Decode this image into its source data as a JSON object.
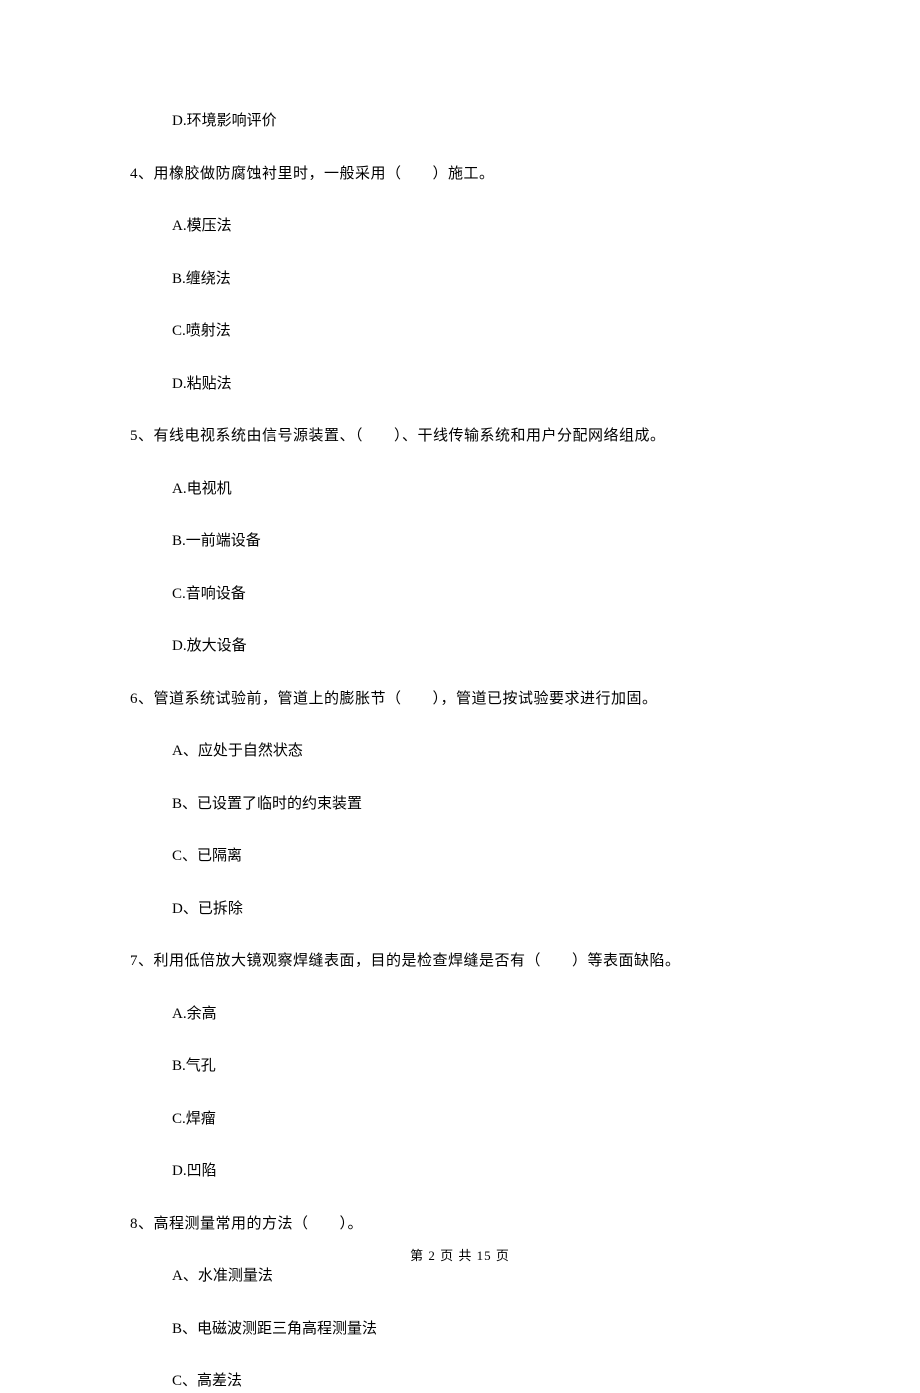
{
  "orphan_option": "D.环境影响评价",
  "questions": [
    {
      "stem": "4、用橡胶做防腐蚀衬里时，一般采用（　　）施工。",
      "options": [
        "A.模压法",
        "B.缠绕法",
        "C.喷射法",
        "D.粘贴法"
      ]
    },
    {
      "stem": "5、有线电视系统由信号源装置、（　　）、干线传输系统和用户分配网络组成。",
      "options": [
        "A.电视机",
        "B.一前端设备",
        "C.音响设备",
        "D.放大设备"
      ]
    },
    {
      "stem": "6、管道系统试验前，管道上的膨胀节（　　），管道已按试验要求进行加固。",
      "options": [
        "A、应处于自然状态",
        "B、已设置了临时的约束装置",
        "C、已隔离",
        "D、已拆除"
      ]
    },
    {
      "stem": "7、利用低倍放大镜观察焊缝表面，目的是检查焊缝是否有（　　）等表面缺陷。",
      "options": [
        "A.余高",
        "B.气孔",
        "C.焊瘤",
        "D.凹陷"
      ]
    },
    {
      "stem": "8、高程测量常用的方法（　　）。",
      "options": [
        "A、水准测量法",
        "B、电磁波测距三角高程测量法",
        "C、高差法"
      ]
    }
  ],
  "footer": "第 2 页 共 15 页"
}
